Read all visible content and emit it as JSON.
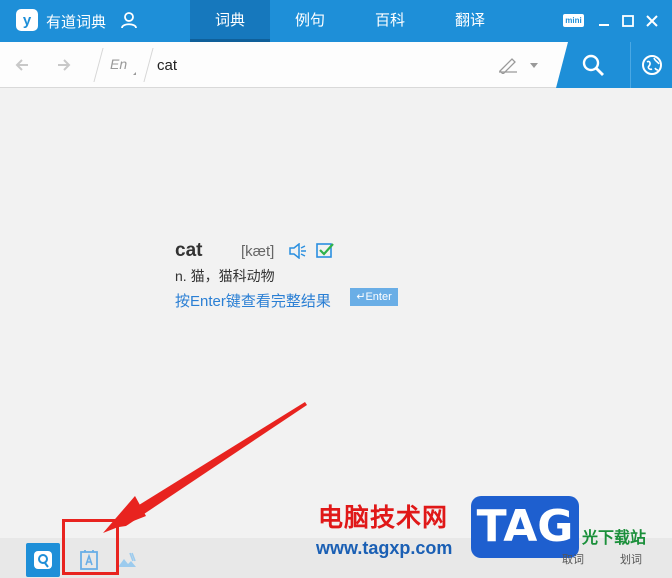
{
  "app": {
    "name": "有道词典",
    "logo_char": "y"
  },
  "tabs": [
    {
      "label": "词典",
      "active": true
    },
    {
      "label": "例句",
      "active": false
    },
    {
      "label": "百科",
      "active": false
    },
    {
      "label": "翻译",
      "active": false
    }
  ],
  "window": {
    "mini_label": "mini"
  },
  "search": {
    "lang": "En",
    "value": "cat"
  },
  "result": {
    "word": "cat",
    "phonetic": "[kæt]",
    "definition": "n. 猫，猫科动物",
    "enter_hint": "按Enter键查看完整结果",
    "enter_badge": "↵Enter"
  },
  "watermark": {
    "cn_text": "电脑技术网",
    "url": "www.tagxp.com",
    "tag": "TAG",
    "site": "光下载站",
    "small_left": "取词",
    "small_right": "划词"
  },
  "colors": {
    "brand": "#1e8fd8",
    "link": "#2a7fd4",
    "annotation": "#e8231f"
  }
}
